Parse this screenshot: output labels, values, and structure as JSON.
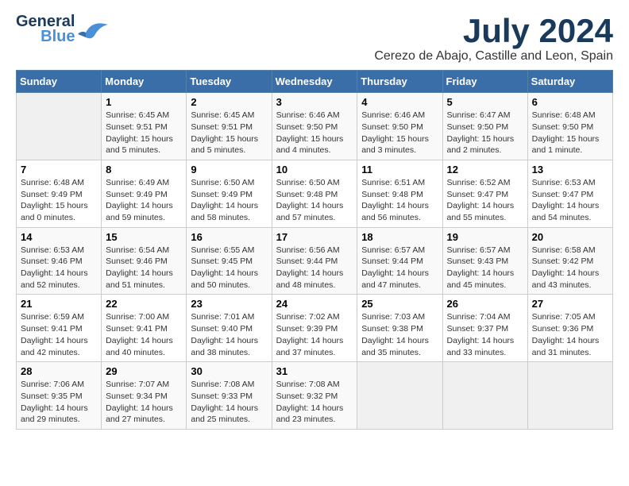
{
  "header": {
    "logo_line1": "General",
    "logo_line2": "Blue",
    "month_title": "July 2024",
    "location": "Cerezo de Abajo, Castille and Leon, Spain"
  },
  "days_of_week": [
    "Sunday",
    "Monday",
    "Tuesday",
    "Wednesday",
    "Thursday",
    "Friday",
    "Saturday"
  ],
  "weeks": [
    [
      {
        "day": "",
        "info": ""
      },
      {
        "day": "1",
        "info": "Sunrise: 6:45 AM\nSunset: 9:51 PM\nDaylight: 15 hours\nand 5 minutes."
      },
      {
        "day": "2",
        "info": "Sunrise: 6:45 AM\nSunset: 9:51 PM\nDaylight: 15 hours\nand 5 minutes."
      },
      {
        "day": "3",
        "info": "Sunrise: 6:46 AM\nSunset: 9:50 PM\nDaylight: 15 hours\nand 4 minutes."
      },
      {
        "day": "4",
        "info": "Sunrise: 6:46 AM\nSunset: 9:50 PM\nDaylight: 15 hours\nand 3 minutes."
      },
      {
        "day": "5",
        "info": "Sunrise: 6:47 AM\nSunset: 9:50 PM\nDaylight: 15 hours\nand 2 minutes."
      },
      {
        "day": "6",
        "info": "Sunrise: 6:48 AM\nSunset: 9:50 PM\nDaylight: 15 hours\nand 1 minute."
      }
    ],
    [
      {
        "day": "7",
        "info": "Sunrise: 6:48 AM\nSunset: 9:49 PM\nDaylight: 15 hours\nand 0 minutes."
      },
      {
        "day": "8",
        "info": "Sunrise: 6:49 AM\nSunset: 9:49 PM\nDaylight: 14 hours\nand 59 minutes."
      },
      {
        "day": "9",
        "info": "Sunrise: 6:50 AM\nSunset: 9:49 PM\nDaylight: 14 hours\nand 58 minutes."
      },
      {
        "day": "10",
        "info": "Sunrise: 6:50 AM\nSunset: 9:48 PM\nDaylight: 14 hours\nand 57 minutes."
      },
      {
        "day": "11",
        "info": "Sunrise: 6:51 AM\nSunset: 9:48 PM\nDaylight: 14 hours\nand 56 minutes."
      },
      {
        "day": "12",
        "info": "Sunrise: 6:52 AM\nSunset: 9:47 PM\nDaylight: 14 hours\nand 55 minutes."
      },
      {
        "day": "13",
        "info": "Sunrise: 6:53 AM\nSunset: 9:47 PM\nDaylight: 14 hours\nand 54 minutes."
      }
    ],
    [
      {
        "day": "14",
        "info": "Sunrise: 6:53 AM\nSunset: 9:46 PM\nDaylight: 14 hours\nand 52 minutes."
      },
      {
        "day": "15",
        "info": "Sunrise: 6:54 AM\nSunset: 9:46 PM\nDaylight: 14 hours\nand 51 minutes."
      },
      {
        "day": "16",
        "info": "Sunrise: 6:55 AM\nSunset: 9:45 PM\nDaylight: 14 hours\nand 50 minutes."
      },
      {
        "day": "17",
        "info": "Sunrise: 6:56 AM\nSunset: 9:44 PM\nDaylight: 14 hours\nand 48 minutes."
      },
      {
        "day": "18",
        "info": "Sunrise: 6:57 AM\nSunset: 9:44 PM\nDaylight: 14 hours\nand 47 minutes."
      },
      {
        "day": "19",
        "info": "Sunrise: 6:57 AM\nSunset: 9:43 PM\nDaylight: 14 hours\nand 45 minutes."
      },
      {
        "day": "20",
        "info": "Sunrise: 6:58 AM\nSunset: 9:42 PM\nDaylight: 14 hours\nand 43 minutes."
      }
    ],
    [
      {
        "day": "21",
        "info": "Sunrise: 6:59 AM\nSunset: 9:41 PM\nDaylight: 14 hours\nand 42 minutes."
      },
      {
        "day": "22",
        "info": "Sunrise: 7:00 AM\nSunset: 9:41 PM\nDaylight: 14 hours\nand 40 minutes."
      },
      {
        "day": "23",
        "info": "Sunrise: 7:01 AM\nSunset: 9:40 PM\nDaylight: 14 hours\nand 38 minutes."
      },
      {
        "day": "24",
        "info": "Sunrise: 7:02 AM\nSunset: 9:39 PM\nDaylight: 14 hours\nand 37 minutes."
      },
      {
        "day": "25",
        "info": "Sunrise: 7:03 AM\nSunset: 9:38 PM\nDaylight: 14 hours\nand 35 minutes."
      },
      {
        "day": "26",
        "info": "Sunrise: 7:04 AM\nSunset: 9:37 PM\nDaylight: 14 hours\nand 33 minutes."
      },
      {
        "day": "27",
        "info": "Sunrise: 7:05 AM\nSunset: 9:36 PM\nDaylight: 14 hours\nand 31 minutes."
      }
    ],
    [
      {
        "day": "28",
        "info": "Sunrise: 7:06 AM\nSunset: 9:35 PM\nDaylight: 14 hours\nand 29 minutes."
      },
      {
        "day": "29",
        "info": "Sunrise: 7:07 AM\nSunset: 9:34 PM\nDaylight: 14 hours\nand 27 minutes."
      },
      {
        "day": "30",
        "info": "Sunrise: 7:08 AM\nSunset: 9:33 PM\nDaylight: 14 hours\nand 25 minutes."
      },
      {
        "day": "31",
        "info": "Sunrise: 7:08 AM\nSunset: 9:32 PM\nDaylight: 14 hours\nand 23 minutes."
      },
      {
        "day": "",
        "info": ""
      },
      {
        "day": "",
        "info": ""
      },
      {
        "day": "",
        "info": ""
      }
    ]
  ]
}
